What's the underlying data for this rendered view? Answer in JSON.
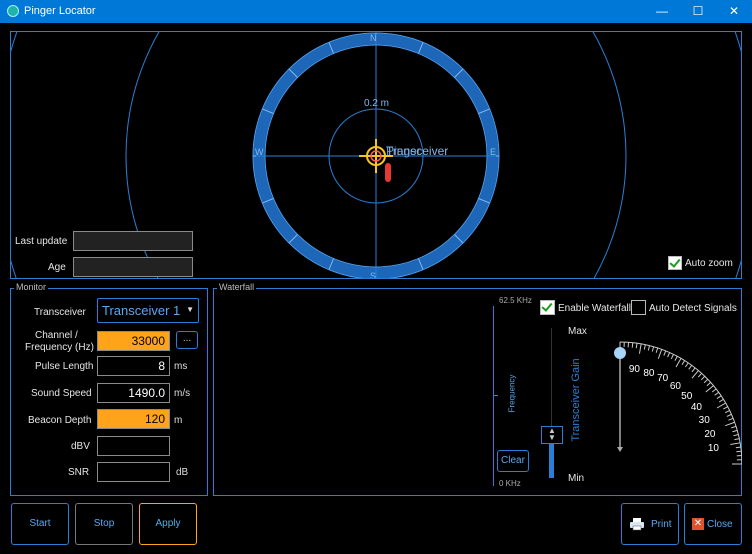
{
  "window": {
    "title": "Pinger Locator",
    "minimize": "—",
    "maximize": "☐",
    "close": "✕"
  },
  "radar": {
    "range_label": "0.2 m",
    "compass": {
      "n": "N",
      "s": "S",
      "e": "E",
      "w": "W"
    },
    "target_label": "Transceiver",
    "target_overlay": "Pinger",
    "last_update_label": "Last update",
    "last_update_value": "",
    "age_label": "Age",
    "age_value": "",
    "auto_zoom_label": "Auto zoom",
    "auto_zoom_checked": true
  },
  "monitor": {
    "title": "Monitor",
    "transceiver_label": "Transceiver",
    "transceiver_value": "Transceiver 1",
    "channel_label_1": "Channel /",
    "channel_label_2": "Frequency (Hz)",
    "channel_value": "33000",
    "ellipsis": "...",
    "pulse_label": "Pulse Length",
    "pulse_value": "8",
    "pulse_unit": "ms",
    "sound_label": "Sound Speed",
    "sound_value": "1490.0",
    "sound_unit": "m/s",
    "depth_label": "Beacon Depth",
    "depth_value": "120",
    "depth_unit": "m",
    "dbv_label": "dBV",
    "dbv_value": "",
    "snr_label": "SNR",
    "snr_value": "",
    "snr_unit": "dB"
  },
  "waterfall": {
    "title": "Waterfall",
    "top_freq": "62.5 KHz",
    "bottom_freq": "0 KHz",
    "axis_label": "Frequency",
    "enable_label": "Enable Waterfall",
    "enable_checked": true,
    "auto_detect_label": "Auto Detect Signals",
    "auto_detect_checked": false,
    "clear_label": "Clear",
    "gain_max": "Max",
    "gain_min": "Min",
    "gain_label": "Transceiver Gain",
    "gain_level": 0.0,
    "dial_ticks": [
      "10",
      "20",
      "30",
      "40",
      "50",
      "60",
      "70",
      "80",
      "90"
    ]
  },
  "buttons": {
    "start": "Start",
    "stop": "Stop",
    "apply": "Apply",
    "print": "Print",
    "close": "Close"
  },
  "colors": {
    "accent": "#2a7fd4",
    "highlight": "#ffa31a",
    "titlebar": "#0078d7"
  }
}
